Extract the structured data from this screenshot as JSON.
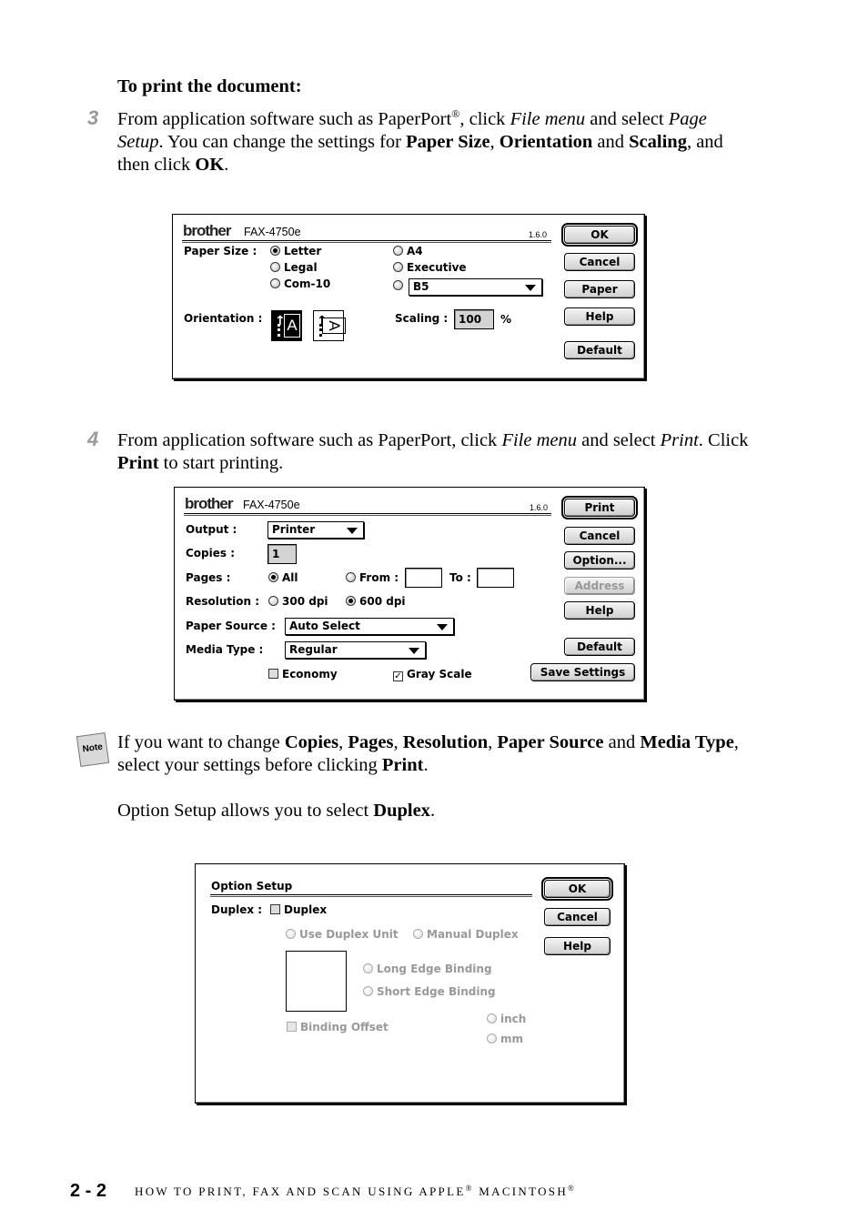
{
  "heading": "To print the document:",
  "step3": {
    "number": "3",
    "t1": "From application software such as PaperPort",
    "reg": "®",
    "t2": ", click ",
    "i1": "File menu",
    "t3": " and select ",
    "i2": "Page Setup",
    "t4": ". You can change the settings for ",
    "b1": "Paper Size",
    "t5": ", ",
    "b2": "Orientation",
    "t6": " and ",
    "b3": "Scaling",
    "t7": ", and then click ",
    "b4": "OK",
    "t8": "."
  },
  "page_setup_dialog": {
    "brand": "brother",
    "model": "FAX-4750e",
    "version": "1.6.0",
    "paper_size_label": "Paper Size :",
    "paper_sizes": [
      {
        "label": "Letter",
        "selected": true
      },
      {
        "label": "Legal",
        "selected": false
      },
      {
        "label": "Com-10",
        "selected": false
      },
      {
        "label": "A4",
        "selected": false
      },
      {
        "label": "Executive",
        "selected": false
      }
    ],
    "other_size_popup": "B5",
    "orientation_label": "Orientation :",
    "orientation_portrait": "A",
    "orientation_landscape": "A",
    "scaling_label": "Scaling :",
    "scaling_value": "100",
    "scaling_unit": "%",
    "buttons": {
      "ok": "OK",
      "cancel": "Cancel",
      "paper": "Paper",
      "help": "Help",
      "default": "Default"
    }
  },
  "step4": {
    "number": "4",
    "t1": "From application software such as PaperPort, click ",
    "i1": "File menu",
    "t2": " and select ",
    "i2": "Print",
    "t3": ". Click ",
    "b1": "Print",
    "t4": " to start printing."
  },
  "print_dialog": {
    "brand": "brother",
    "model": "FAX-4750e",
    "version": "1.6.0",
    "output_label": "Output :",
    "output_value": "Printer",
    "copies_label": "Copies :",
    "copies_value": "1",
    "pages_label": "Pages :",
    "pages_all": "All",
    "pages_from": "From :",
    "pages_from_value": "",
    "pages_to": "To :",
    "pages_to_value": "",
    "resolution_label": "Resolution :",
    "res_300": "300 dpi",
    "res_600": "600 dpi",
    "paper_source_label": "Paper Source :",
    "paper_source_value": "Auto Select",
    "media_type_label": "Media Type :",
    "media_type_value": "Regular",
    "economy": "Economy",
    "economy_checked": false,
    "gray_scale": "Gray Scale",
    "gray_scale_checked": true,
    "buttons": {
      "print": "Print",
      "cancel": "Cancel",
      "option": "Option...",
      "address": "Address",
      "help": "Help",
      "default": "Default",
      "save": "Save Settings"
    }
  },
  "note": {
    "icon": "Note",
    "t1": "If you want to change ",
    "b1": "Copies",
    "c1": ", ",
    "b2": "Pages",
    "c2": ", ",
    "b3": "Resolution",
    "c3": ", ",
    "b4": "Paper Source",
    "t2": " and ",
    "b5": "Media Type",
    "t3": ", select your settings before clicking ",
    "b6": "Print",
    "t4": ".",
    "p2_t1": "Option Setup allows you to select ",
    "p2_b1": "Duplex",
    "p2_t2": "."
  },
  "option_dialog": {
    "title": "Option Setup",
    "duplex_label": "Duplex :",
    "duplex_check": "Duplex",
    "use_unit": "Use Duplex Unit",
    "manual": "Manual Duplex",
    "long_edge": "Long Edge Binding",
    "short_edge": "Short Edge Binding",
    "binding_offset": "Binding Offset",
    "inch": "inch",
    "mm": "mm",
    "buttons": {
      "ok": "OK",
      "cancel": "Cancel",
      "help": "Help"
    }
  },
  "footer": {
    "page": "2 - 2",
    "title1": "HOW TO PRINT, FAX AND SCAN USING APPLE",
    "reg": "®",
    "title2": " MACINTOSH",
    "reg2": "®"
  }
}
